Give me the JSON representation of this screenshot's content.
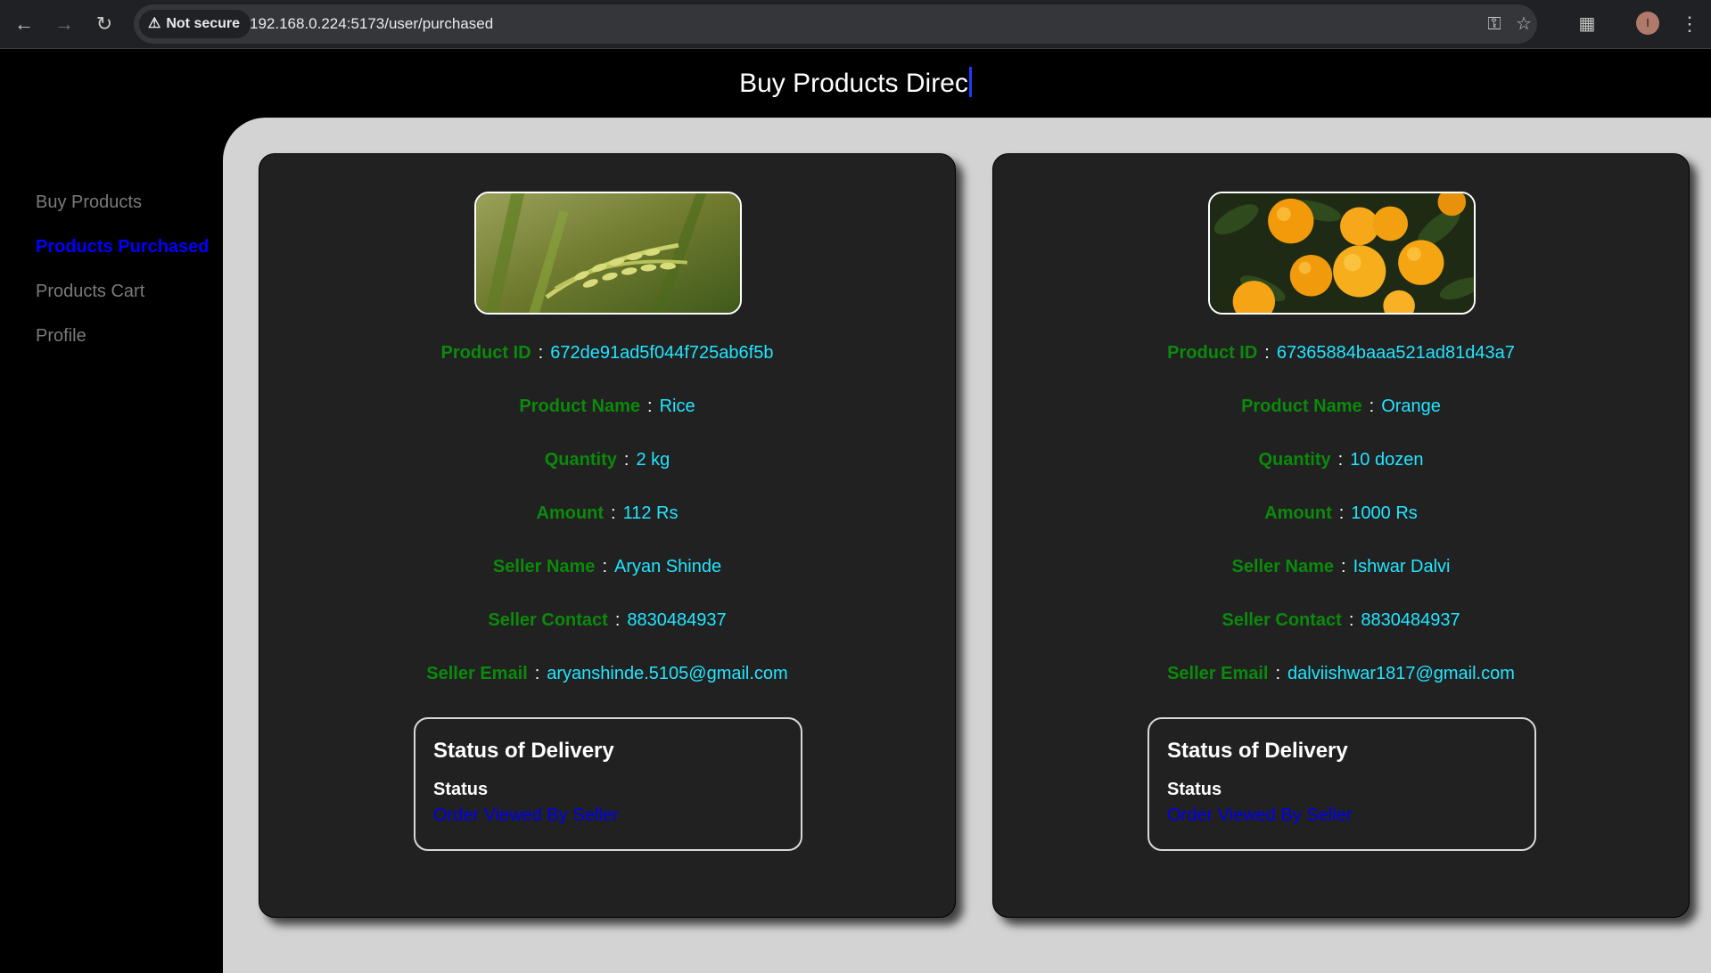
{
  "browser": {
    "security_label": "Not secure",
    "url": "192.168.0.224:5173/user/purchased",
    "profile_initial": "I"
  },
  "app": {
    "title": "Buy Products Direc"
  },
  "sidebar": {
    "items": [
      {
        "label": "Buy Products",
        "active": false
      },
      {
        "label": "Products Purchased",
        "active": true
      },
      {
        "label": "Products Cart",
        "active": false
      },
      {
        "label": "Profile",
        "active": false
      }
    ]
  },
  "labels": {
    "product_id": "Product ID",
    "product_name": "Product Name",
    "quantity": "Quantity",
    "amount": "Amount",
    "seller_name": "Seller Name",
    "seller_contact": "Seller Contact",
    "seller_email": "Seller Email",
    "separator": ":",
    "status_heading": "Status of Delivery",
    "status_label": "Status"
  },
  "products": [
    {
      "image": "rice-plant-image",
      "product_id": "672de91ad5f044f725ab6f5b",
      "product_name": "Rice",
      "quantity": "2 kg",
      "amount": "112 Rs",
      "seller_name": "Aryan Shinde",
      "seller_contact": "8830484937",
      "seller_email": "aryanshinde.5105@gmail.com",
      "status": "Order Viewed By Seller"
    },
    {
      "image": "oranges-image",
      "product_id": "67365884baaa521ad81d43a7",
      "product_name": "Orange",
      "quantity": "10 dozen",
      "amount": "1000 Rs",
      "seller_name": "Ishwar Dalvi",
      "seller_contact": "8830484937",
      "seller_email": "dalviishwar1817@gmail.com",
      "status": "Order Viewed By Seller"
    }
  ],
  "colors": {
    "label_green": "#0b8a0b",
    "value_cyan": "#22e5ff",
    "active_blue": "#0000ff",
    "status_blue": "#0000ee",
    "card_bg": "#212121",
    "panel_bg": "#d3d3d3"
  }
}
